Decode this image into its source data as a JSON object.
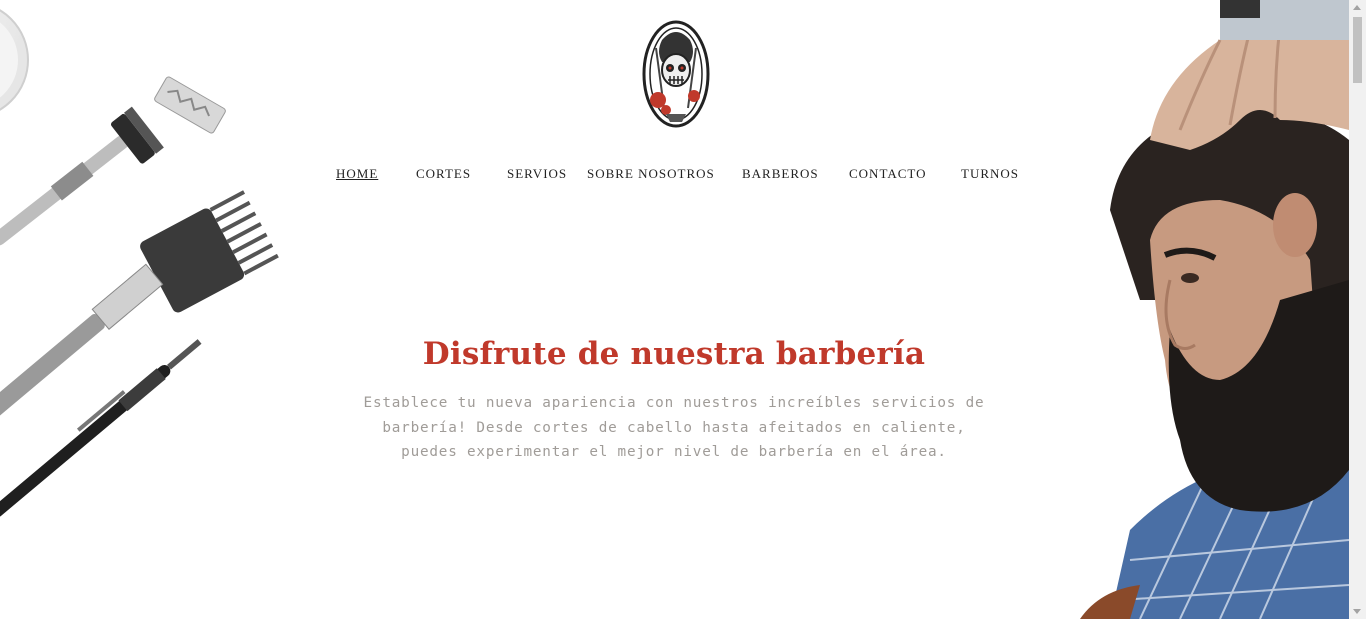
{
  "brand": {
    "logo_icon": "barber-skull-logo-icon"
  },
  "nav": {
    "items": [
      {
        "label": "HOME",
        "active": true
      },
      {
        "label": "CORTES"
      },
      {
        "label": "SERVIOS"
      },
      {
        "label": "SOBRE NOSOTROS"
      },
      {
        "label": "BARBEROS"
      },
      {
        "label": "CONTACTO"
      },
      {
        "label": "TURNOS"
      }
    ]
  },
  "hero": {
    "title": "Disfrute de nuestra barbería",
    "text": "Establece tu nueva apariencia con nuestros increíbles servicios de barbería! Desde cortes de cabello hasta afeitados en caliente, puedes experimentar el mejor nivel de barbería en el área."
  },
  "colors": {
    "accent": "#c0392b",
    "body_text": "#a09c98",
    "nav_text": "#222222"
  }
}
